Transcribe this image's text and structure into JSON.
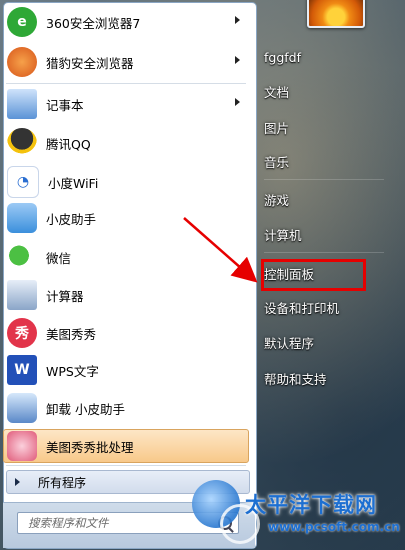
{
  "left_menu": {
    "items": [
      {
        "label": "360安全浏览器7",
        "icon": "360-browser-icon",
        "color": "#2ea836",
        "glyph": "e",
        "has_submenu": true
      },
      {
        "label": "猎豹安全浏览器",
        "icon": "cheetah-browser-icon",
        "color": "#e06a1e",
        "glyph": "",
        "has_submenu": true
      },
      {
        "label": "记事本",
        "icon": "notepad-icon",
        "color": "#4f8fd8",
        "glyph": "",
        "has_submenu": true
      },
      {
        "label": "腾讯QQ",
        "icon": "qq-icon",
        "color": "#111111",
        "glyph": "",
        "has_submenu": false
      },
      {
        "label": "小度WiFi",
        "icon": "wifi-icon",
        "color": "#2a6ed1",
        "glyph": "",
        "has_submenu": false
      },
      {
        "label": "小皮助手",
        "icon": "xiaopi-icon",
        "color": "#3b8fdc",
        "glyph": "",
        "has_submenu": false
      },
      {
        "label": "微信",
        "icon": "wechat-icon",
        "color": "#3cb034",
        "glyph": "",
        "has_submenu": false
      },
      {
        "label": "计算器",
        "icon": "calculator-icon",
        "color": "#6c8fb8",
        "glyph": "",
        "has_submenu": false
      },
      {
        "label": "美图秀秀",
        "icon": "meitu-icon",
        "color": "#e2344a",
        "glyph": "秀",
        "has_submenu": false
      },
      {
        "label": "WPS文字",
        "icon": "wps-writer-icon",
        "color": "#2250b8",
        "glyph": "W",
        "has_submenu": false
      },
      {
        "label": "卸载 小皮助手",
        "icon": "uninstall-icon",
        "color": "#5a88c8",
        "glyph": "",
        "has_submenu": false
      },
      {
        "label": "美图秀秀批处理",
        "icon": "meitu-batch-icon",
        "color": "#e05b7a",
        "glyph": "",
        "has_submenu": false
      }
    ],
    "all_programs": "所有程序"
  },
  "search": {
    "placeholder": "搜索程序和文件"
  },
  "right_menu": {
    "items": [
      {
        "label": "fggfdf"
      },
      {
        "label": "文档"
      },
      {
        "label": "图片"
      },
      {
        "label": "音乐"
      },
      {
        "label": "游戏"
      },
      {
        "label": "计算机"
      },
      {
        "label": "控制面板"
      },
      {
        "label": "设备和打印机"
      },
      {
        "label": "默认程序"
      },
      {
        "label": "帮助和支持"
      }
    ]
  },
  "annotation": {
    "highlight_target": "控制面板",
    "color": "#e60000"
  },
  "watermark": {
    "title": "太平洋下载网",
    "url": "www.pcsoft.com.cn"
  }
}
